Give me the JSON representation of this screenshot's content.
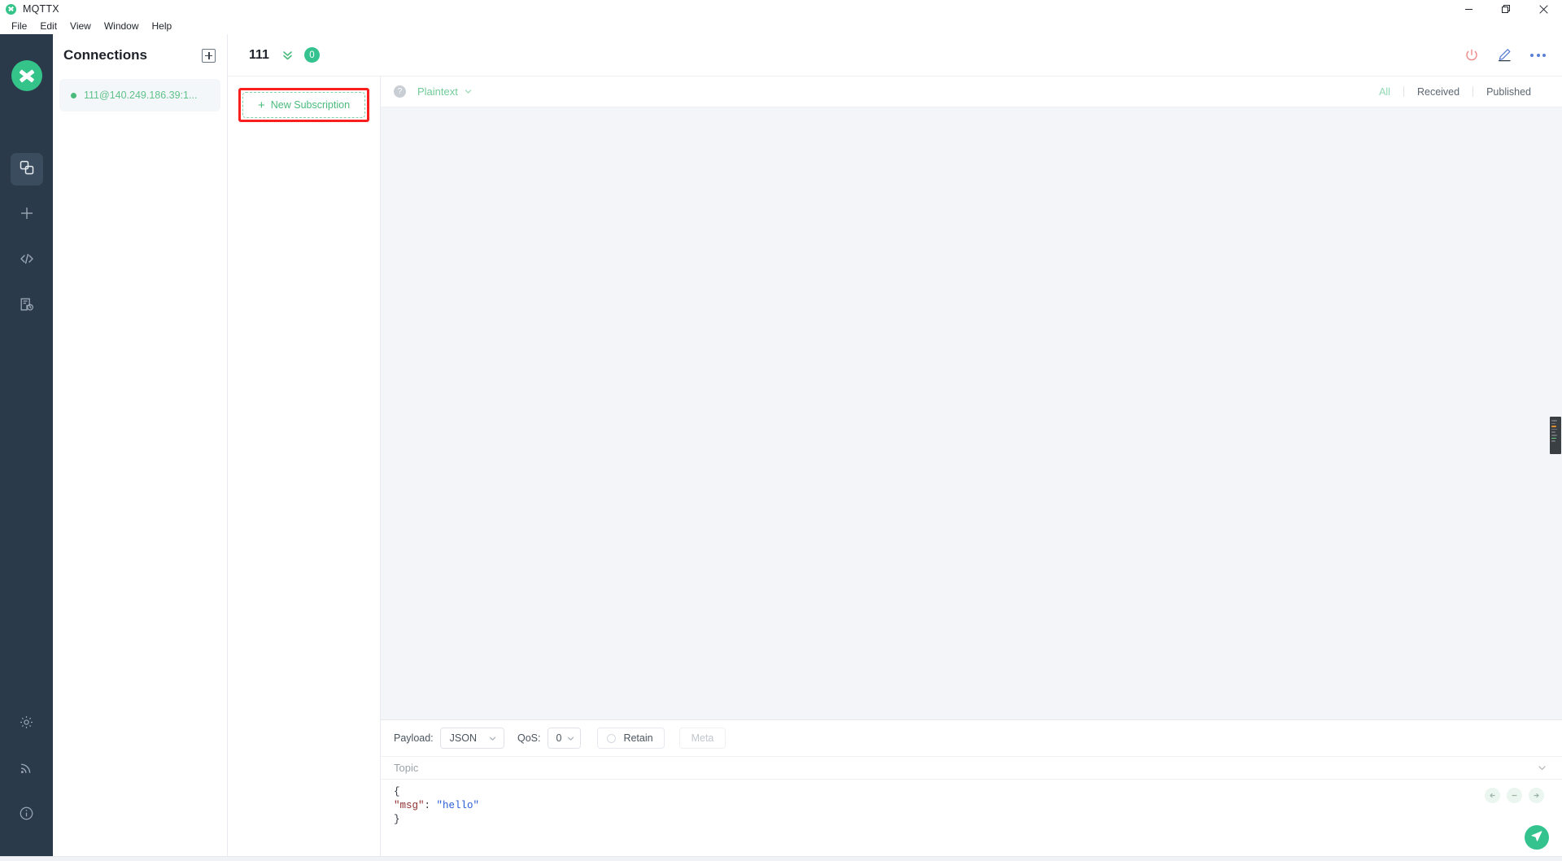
{
  "window": {
    "app_name": "MQTTX",
    "logo_icon": "mqttx-logo-icon",
    "controls": {
      "minimize": "minimize-icon",
      "maximize": "maximize-icon",
      "close": "close-icon"
    }
  },
  "menubar": {
    "items": [
      {
        "label": "File"
      },
      {
        "label": "Edit"
      },
      {
        "label": "View"
      },
      {
        "label": "Window"
      },
      {
        "label": "Help"
      }
    ]
  },
  "rail": {
    "items": [
      {
        "name": "connections-icon",
        "active": true
      },
      {
        "name": "new-connection-icon",
        "active": false
      },
      {
        "name": "code-icon",
        "active": false
      },
      {
        "name": "log-icon",
        "active": false
      }
    ],
    "bottom_items": [
      {
        "name": "settings-icon"
      },
      {
        "name": "broadcast-icon"
      },
      {
        "name": "about-icon"
      }
    ]
  },
  "connections": {
    "title": "Connections",
    "add_icon": "plus-square-icon",
    "items": [
      {
        "name": "111@140.249.186.39:1...",
        "status": "connected",
        "status_color": "#49bb7c"
      }
    ]
  },
  "header": {
    "title": "111",
    "collapse_icon": "double-chevron-down-icon",
    "message_count": "0",
    "actions": [
      {
        "name": "disconnect-icon"
      },
      {
        "name": "edit-icon"
      },
      {
        "name": "more-icon"
      }
    ]
  },
  "subscriptions": {
    "new_subscription_label": "New Subscription",
    "plus_icon": "plus-icon",
    "highlight_color": "#f91f1f"
  },
  "messages": {
    "help_icon": "question-circle-icon",
    "format_label": "Plaintext",
    "format_chevron": "chevron-down-icon",
    "filters": [
      {
        "label": "All",
        "active": true
      },
      {
        "label": "Received",
        "active": false
      },
      {
        "label": "Published",
        "active": false
      }
    ],
    "list": []
  },
  "publish": {
    "payload_label": "Payload:",
    "payload_value": "JSON",
    "qos_label": "QoS:",
    "qos_value": "0",
    "retain_label": "Retain",
    "retain_checked": false,
    "meta_label": "Meta",
    "topic_placeholder": "Topic",
    "topic_value": "",
    "topic_chevron": "chevron-down-icon",
    "editor": {
      "line1": "{",
      "line2_key": "\"msg\"",
      "line2_colon": ": ",
      "line2_value": "\"hello\"",
      "line3": "}"
    },
    "editor_controls": [
      {
        "name": "prev-icon"
      },
      {
        "name": "collapse-icon"
      },
      {
        "name": "next-icon"
      }
    ],
    "send_icon": "send-icon",
    "send_color": "#34c38f"
  },
  "colors": {
    "accent_green": "#34c38f",
    "rail_bg": "#2b3a4a",
    "message_bg": "#f3f5f9"
  }
}
